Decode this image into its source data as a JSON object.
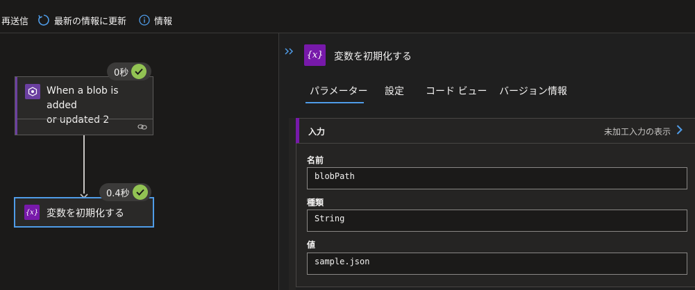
{
  "toolbar": {
    "resend_label": "再送信",
    "refresh_label": "最新の情報に更新",
    "info_label": "情報"
  },
  "canvas": {
    "trigger": {
      "title_line1": "When a blob is added",
      "title_line2": "or updated 2",
      "duration": "0秒",
      "accent_color": "#6b3fa0"
    },
    "action": {
      "title": "変数を初期化する",
      "duration": "0.4秒",
      "accent_color": "#7719aa",
      "selected_border": "#4f9ce8"
    }
  },
  "panel": {
    "title": "変数を初期化する",
    "icon_text": "{x}",
    "tabs": [
      {
        "label": "パラメーター",
        "active": true
      },
      {
        "label": "設定",
        "active": false
      },
      {
        "label": "コード ビュー",
        "active": false
      },
      {
        "label": "バージョン情報",
        "active": false
      }
    ],
    "inputs": {
      "title": "入力",
      "raw_link": "未加工入力の表示",
      "fields": [
        {
          "label": "名前",
          "value": "blobPath"
        },
        {
          "label": "種類",
          "value": "String"
        },
        {
          "label": "値",
          "value": "sample.json"
        }
      ]
    }
  },
  "colors": {
    "background": "#1b1a19",
    "accent_blue": "#4f9ce8",
    "success_green": "#92c353",
    "variable_purple": "#7719aa"
  }
}
